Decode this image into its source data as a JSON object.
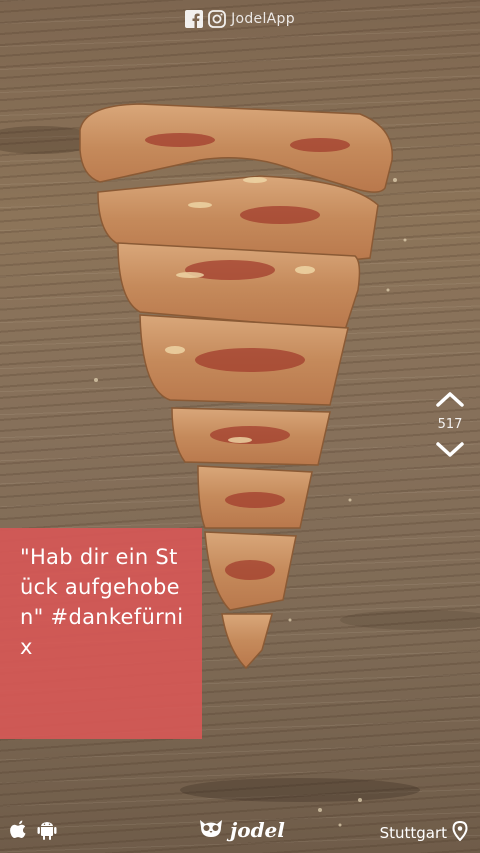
{
  "header": {
    "handle": "JodelApp",
    "icons": [
      "facebook-icon",
      "instagram-icon"
    ]
  },
  "post": {
    "text": "\"Hab dir ein Stück aufgehoben\" #dankefürnix",
    "card_color": "#d65856",
    "vote_count": "517"
  },
  "footer": {
    "brand": "jodel",
    "location": "Stuttgart",
    "icons": [
      "apple-icon",
      "android-icon",
      "jodel-owl-icon",
      "location-pin-icon"
    ]
  }
}
